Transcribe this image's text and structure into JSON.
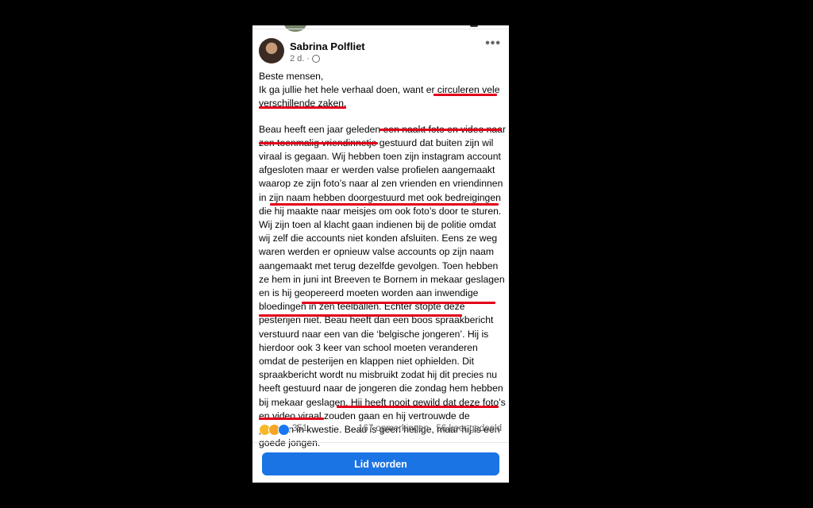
{
  "post": {
    "author": "Sabrina Polfliet",
    "time": "2 d.",
    "more": "•••",
    "greeting": "Beste mensen,",
    "intro": "Ik ga jullie het hele verhaal doen, want  er circuleren vele verschillende zaken.",
    "body": "Beau heeft een jaar geleden een naakt foto en video naar zen toenmalig vriendinnetje gestuurd dat buiten zijn wil viraal is gegaan. Wij hebben toen zijn instagram account afgesloten maar er werden valse profielen aangemaakt waarop ze zijn foto’s naar al zen vrienden en vriendinnen in zijn naam hebben doorgestuurd met ook bedreigingen die hij maakte naar meisjes om ook foto’s door te sturen. Wij zijn toen al klacht gaan indienen bij de politie omdat wij zelf die accounts niet konden afsluiten. Eens ze weg waren werden er opnieuw valse accounts op zijn naam aangemaakt met terug dezelfde gevolgen. Toen hebben ze hem in juni int Breeven te Bornem in mekaar geslagen en is hij geopereerd moeten worden aan inwendige bloedingen in zen teelballen. Echter stopte deze pesterijen niet. Beau heeft dan een boos spraakbericht verstuurd naar een van die ‘belgische jongeren’. Hij is hierdoor ook 3 keer van school moeten veranderen omdat de pesterijen en klappen niet ophielden. Dit spraakbericht wordt nu misbruikt zodat hij dit precies nu heeft gestuurd naar de jongeren die zondag hem hebben bij mekaar geslagen. Hij heeft nooit gewild dat deze foto’s en video viraal zouden gaan en hij vertrouwde de persoon in kwestie. Beau is geen heilige, maar hij is een goede jongen."
  },
  "stats": {
    "reactions": "351",
    "comments": "167 opmerkingen",
    "shares": "56 keer gedeeld"
  },
  "join_button": "Lid worden",
  "colors": {
    "underline": "#e2001a",
    "button": "#1b74e4"
  }
}
